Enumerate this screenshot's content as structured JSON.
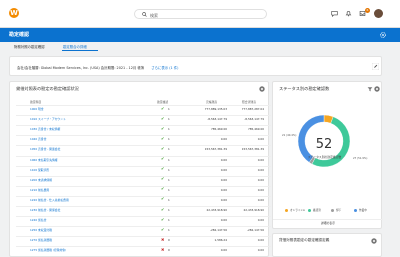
{
  "topbar": {
    "search_placeholder": "検索",
    "notif_count": "6"
  },
  "header": {
    "title": "勘定確認"
  },
  "tabs": [
    {
      "label": "財務対照の勘定確認"
    },
    {
      "label": "勘定照合の詳細"
    }
  ],
  "info": {
    "fields": "会社/会社階層: Global Modern Services, Inc. (USA)   会計期間: 2021 - 12月   帳簿",
    "more": "さらに表示 (1 件)"
  },
  "table_card": {
    "title": "貸借対照表の勘定の勘定確認状況",
    "columns": [
      "勘定科目",
      "勘定確認",
      "",
      "元帳残高",
      "照合済残高"
    ],
    "rows": [
      {
        "account": "1000 現金",
        "status": "ok",
        "count": "1",
        "ledger": "777,889,135.03",
        "reconciled": "777,887,287.04"
      },
      {
        "account": "1010 スイープ・アカウント",
        "status": "ok",
        "count": "1",
        "ledger": "-8,563,147.79",
        "reconciled": "-8,563,147.79"
      },
      {
        "account": "1030 売掛金 / 未収債権",
        "status": "ok",
        "count": "1",
        "ledger": "785,469.00",
        "reconciled": "785,469.00"
      },
      {
        "account": "1040 売掛金",
        "status": "ok",
        "count": "1",
        "ledger": "0.00",
        "reconciled": "0.00"
      },
      {
        "account": "1050 売掛金 - 関連会社",
        "status": "ok",
        "count": "1",
        "ledger": "153,567,381.39",
        "reconciled": "153,567,381.39"
      },
      {
        "account": "1060 未払取引先債権",
        "status": "ok",
        "count": "1",
        "ledger": "0.00",
        "reconciled": "0.00"
      },
      {
        "account": "1100 受取手形",
        "status": "ok",
        "count": "1",
        "ledger": "0.00",
        "reconciled": "0.00"
      },
      {
        "account": "1200 未請求債権",
        "status": "ok",
        "count": "1",
        "ledger": "0.00",
        "reconciled": "0.00"
      },
      {
        "account": "1210 前払費用",
        "status": "ok",
        "count": "1",
        "ledger": "0.00",
        "reconciled": "0.00"
      },
      {
        "account": "1220 前払金 - 仕入先前払費用",
        "status": "ok",
        "count": "1",
        "ledger": "0.00",
        "reconciled": "0.00"
      },
      {
        "account": "1230 前払金 - 関係会社",
        "status": "ok",
        "count": "1",
        "ledger": "22,433,918.90",
        "reconciled": "22,433,918.90"
      },
      {
        "account": "1240 仮払金",
        "status": "ok",
        "count": "1",
        "ledger": "0.00",
        "reconciled": "0.00"
      },
      {
        "account": "1250 未収還付税",
        "status": "ok",
        "count": "1",
        "ledger": "-282,147.56",
        "reconciled": "-282,147.56"
      },
      {
        "account": "1270 仮払消費税",
        "status": "err",
        "count": "0",
        "ledger": "1,586.24",
        "reconciled": "0.00"
      },
      {
        "account": "1275 仮払消費税 (控除対象)",
        "status": "err",
        "count": "0",
        "ledger": "0.00",
        "reconciled": "0.00"
      }
    ]
  },
  "status_card": {
    "title": "ステータス別の勘定確認数",
    "total": "52",
    "subtitle": "ステータス別の勘定確認数",
    "slice_labels": [
      "21 (40.4%)",
      "27 (51.9%)"
    ],
    "legend": [
      {
        "label": "オンラインA",
        "color": "#f5a623"
      },
      {
        "label": "確認済",
        "color": "#3ec99a"
      },
      {
        "label": "却下",
        "color": "#9e9e9e"
      },
      {
        "label": "作業中",
        "color": "#4a90e2"
      }
    ],
    "footer": "詳細の表示"
  },
  "bottom_card": {
    "title": "貸借対照表勘定の勘定確認定義"
  },
  "chart_data": {
    "type": "pie",
    "title": "ステータス別の勘定確認数",
    "total": 52,
    "categories": [
      "オンラインA",
      "確認済",
      "却下",
      "作業中"
    ],
    "values": [
      3,
      27,
      1,
      21
    ],
    "colors": [
      "#f5a623",
      "#3ec99a",
      "#9e9e9e",
      "#4a90e2"
    ],
    "hole": true,
    "legend_position": "bottom"
  }
}
